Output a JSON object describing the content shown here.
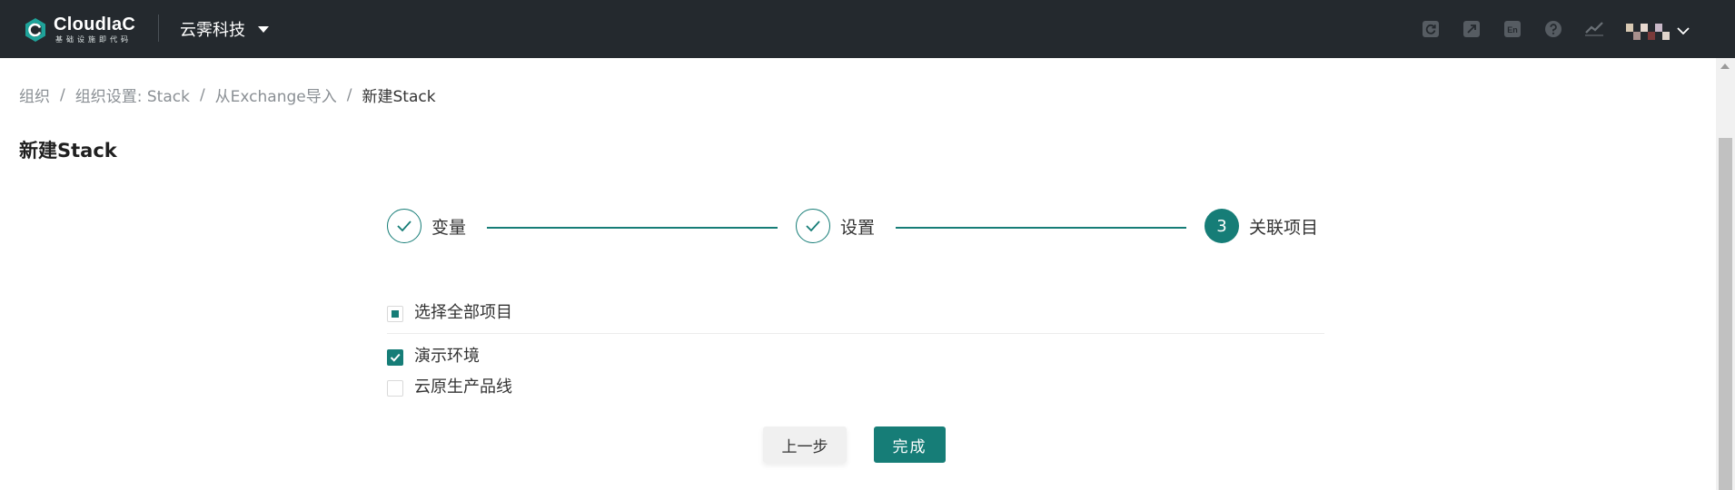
{
  "header": {
    "brand": "CloudIaC",
    "brand_sub": "基础设施即代码",
    "org_name": "云霁科技",
    "icons": [
      "refresh-icon",
      "external-link-icon",
      "language-en-icon",
      "help-icon",
      "trend-chart-icon"
    ],
    "language_icon_text": "En",
    "avatar_colors": [
      "#d8c9b3",
      "#a8908c",
      "#e8d9d0",
      "#7a3a3a",
      "#c9b8c8",
      "#e0d4cc"
    ]
  },
  "breadcrumb": {
    "items": [
      "组织",
      "组织设置: Stack",
      "从Exchange导入"
    ],
    "current": "新建Stack",
    "separator": "/"
  },
  "page": {
    "title": "新建Stack"
  },
  "steps": [
    {
      "label": "变量",
      "status": "done"
    },
    {
      "label": "设置",
      "status": "done"
    },
    {
      "label": "关联项目",
      "status": "active",
      "number": "3"
    }
  ],
  "selection": {
    "select_all_label": "选择全部项目",
    "select_all_state": "indeterminate",
    "projects": [
      {
        "label": "演示环境",
        "checked": true
      },
      {
        "label": "云原生产品线",
        "checked": false
      }
    ]
  },
  "actions": {
    "prev_label": "上一步",
    "finish_label": "完成"
  },
  "colors": {
    "accent": "#167d77",
    "topbar": "#24292e"
  }
}
